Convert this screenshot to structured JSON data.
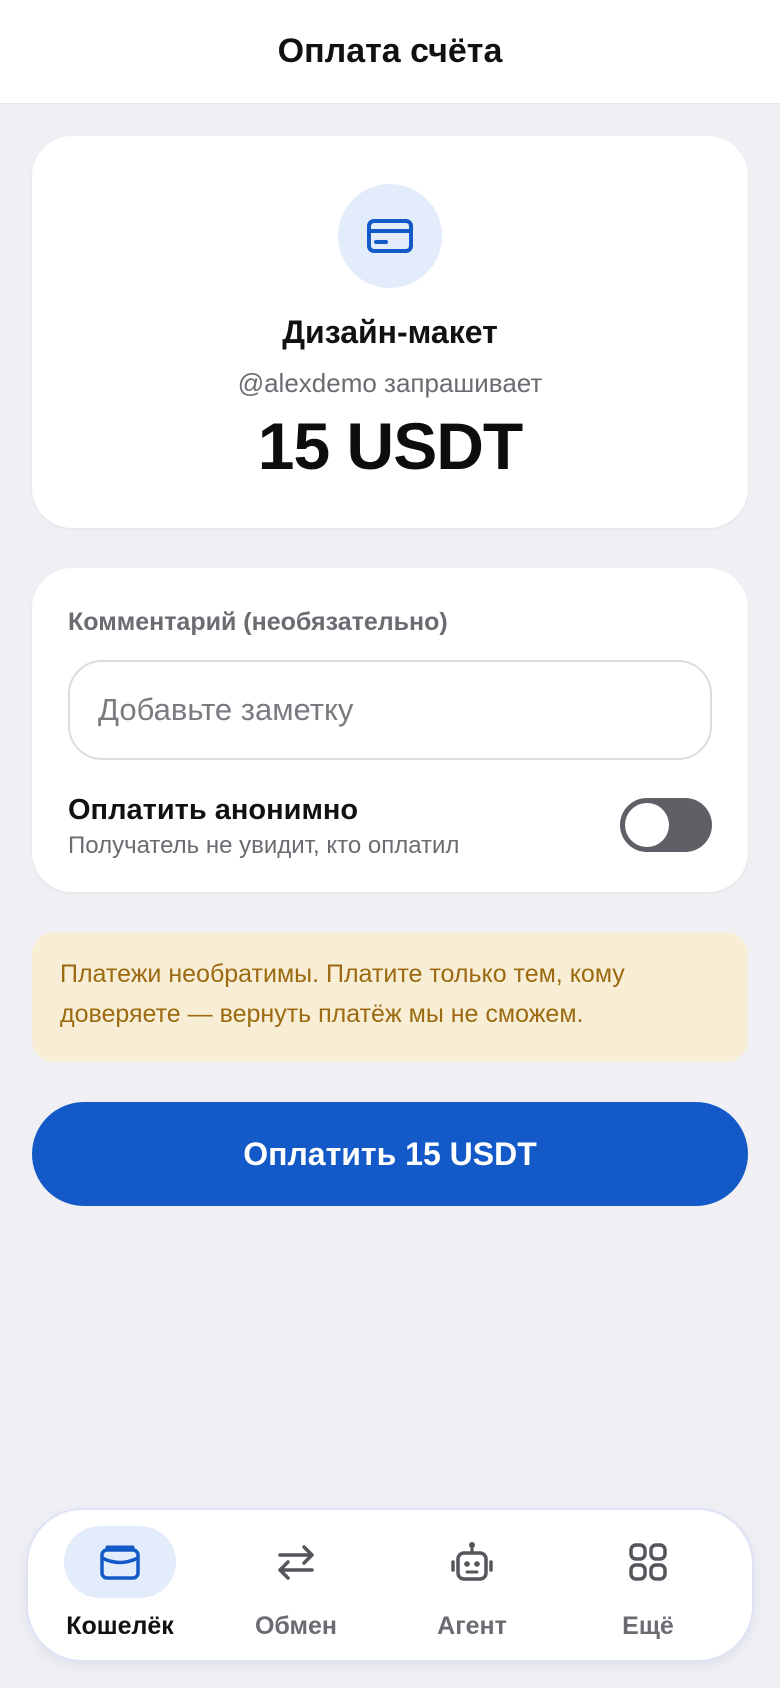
{
  "header": {
    "title": "Оплата счёта"
  },
  "invoice": {
    "icon": "credit-card-icon",
    "title": "Дизайн-макет",
    "requester": "@alexdemo запрашивает",
    "amount": "15 USDT"
  },
  "comment": {
    "label": "Комментарий (необязательно)",
    "placeholder": "Добавьте заметку",
    "value": ""
  },
  "anonymous": {
    "title": "Оплатить анонимно",
    "subtitle": "Получатель не увидит, кто оплатил",
    "enabled": false
  },
  "warning": {
    "text": "Платежи необратимы. Платите только тем, кому доверяете — вернуть платёж мы не сможем."
  },
  "pay_button": {
    "label": "Оплатить 15 USDT"
  },
  "tabbar": {
    "items": [
      {
        "label": "Кошелёк",
        "icon": "wallet-icon",
        "active": true
      },
      {
        "label": "Обмен",
        "icon": "swap-arrows-icon",
        "active": false
      },
      {
        "label": "Агент",
        "icon": "robot-icon",
        "active": false
      },
      {
        "label": "Ещё",
        "icon": "grid-icon",
        "active": false
      }
    ]
  },
  "colors": {
    "accent": "#1459c8",
    "accent_light": "#e3ecfb",
    "warning_bg": "#f8eed6",
    "warning_text": "#9c6a10",
    "background": "#f0f0f4"
  }
}
